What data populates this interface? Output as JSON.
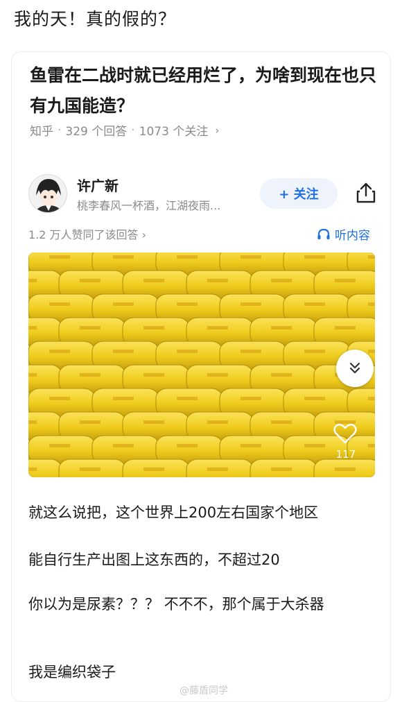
{
  "caption": "我的天！真的假的？",
  "question": {
    "title": "鱼雷在二战时就已经用烂了，为啥到现在也只有九国能造？",
    "source": "知乎",
    "answers": "329 个回答",
    "followers": "1073 个关注",
    "chevron": "›"
  },
  "author": {
    "name": "许广新",
    "bio": "桃李春风一杯酒，江湖夜雨...",
    "follow_label": "+ 关注"
  },
  "stats": {
    "likes_line": "1.2 万人赞同了该回答 ›",
    "listen_label": "听内容"
  },
  "photo": {
    "like_count": "117"
  },
  "paragraphs": [
    "就这么说把，这个世界上200左右国家个地区",
    "能自行生产出图上这东西的，不超过20",
    "你以为是尿素？？？ 不不不，那个属于大杀器",
    "我是编织袋子"
  ],
  "watermark": "@藤盾同学",
  "colors": {
    "accent": "#1f6fe6",
    "bag_yellow": "#f2d21a"
  }
}
